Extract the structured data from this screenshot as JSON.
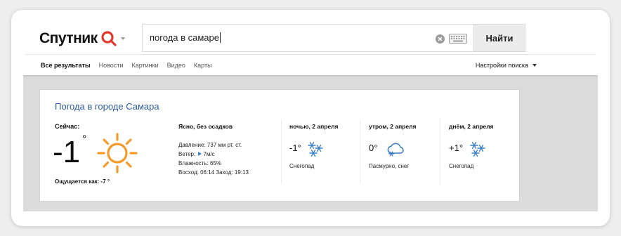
{
  "header": {
    "logo_text": "Спутник",
    "search_value": "погода в самаре",
    "find_label": "Найти"
  },
  "tabs": [
    {
      "label": "Все результаты",
      "active": true
    },
    {
      "label": "Новости",
      "active": false
    },
    {
      "label": "Картинки",
      "active": false
    },
    {
      "label": "Видео",
      "active": false
    },
    {
      "label": "Карты",
      "active": false
    }
  ],
  "settings_label": "Настройки поиска",
  "weather": {
    "title": "Погода в городе Самара",
    "now_label": "Сейчас:",
    "now_temp": "-1",
    "degree": "°",
    "now_icon": "sun-icon",
    "feels_like": "Ощущается как: -7 °",
    "condition": "Ясно, без осадков",
    "pressure": "Давление: 737 мм рт. ст.",
    "wind_label": "Ветер:",
    "wind_value": "7м/с",
    "humidity": "Влажность: 65%",
    "sun_times": "Восход: 06:14 Заход: 19:13",
    "forecast": [
      {
        "title": "ночью, 2 апреля",
        "temp": "-1°",
        "icon": "snow-icon",
        "desc": "Снегопад"
      },
      {
        "title": "утром, 2 апреля",
        "temp": "0°",
        "icon": "cloud-snow-icon",
        "desc": "Пасмурно, снег"
      },
      {
        "title": "днём, 2 апреля",
        "temp": "+1°",
        "icon": "snow-icon",
        "desc": "Снегопад"
      }
    ]
  },
  "colors": {
    "accent_blue": "#2c5aa0",
    "logo_red": "#e03a2f",
    "sun_orange": "#f39c2b",
    "snow_blue": "#3a7fc4"
  }
}
